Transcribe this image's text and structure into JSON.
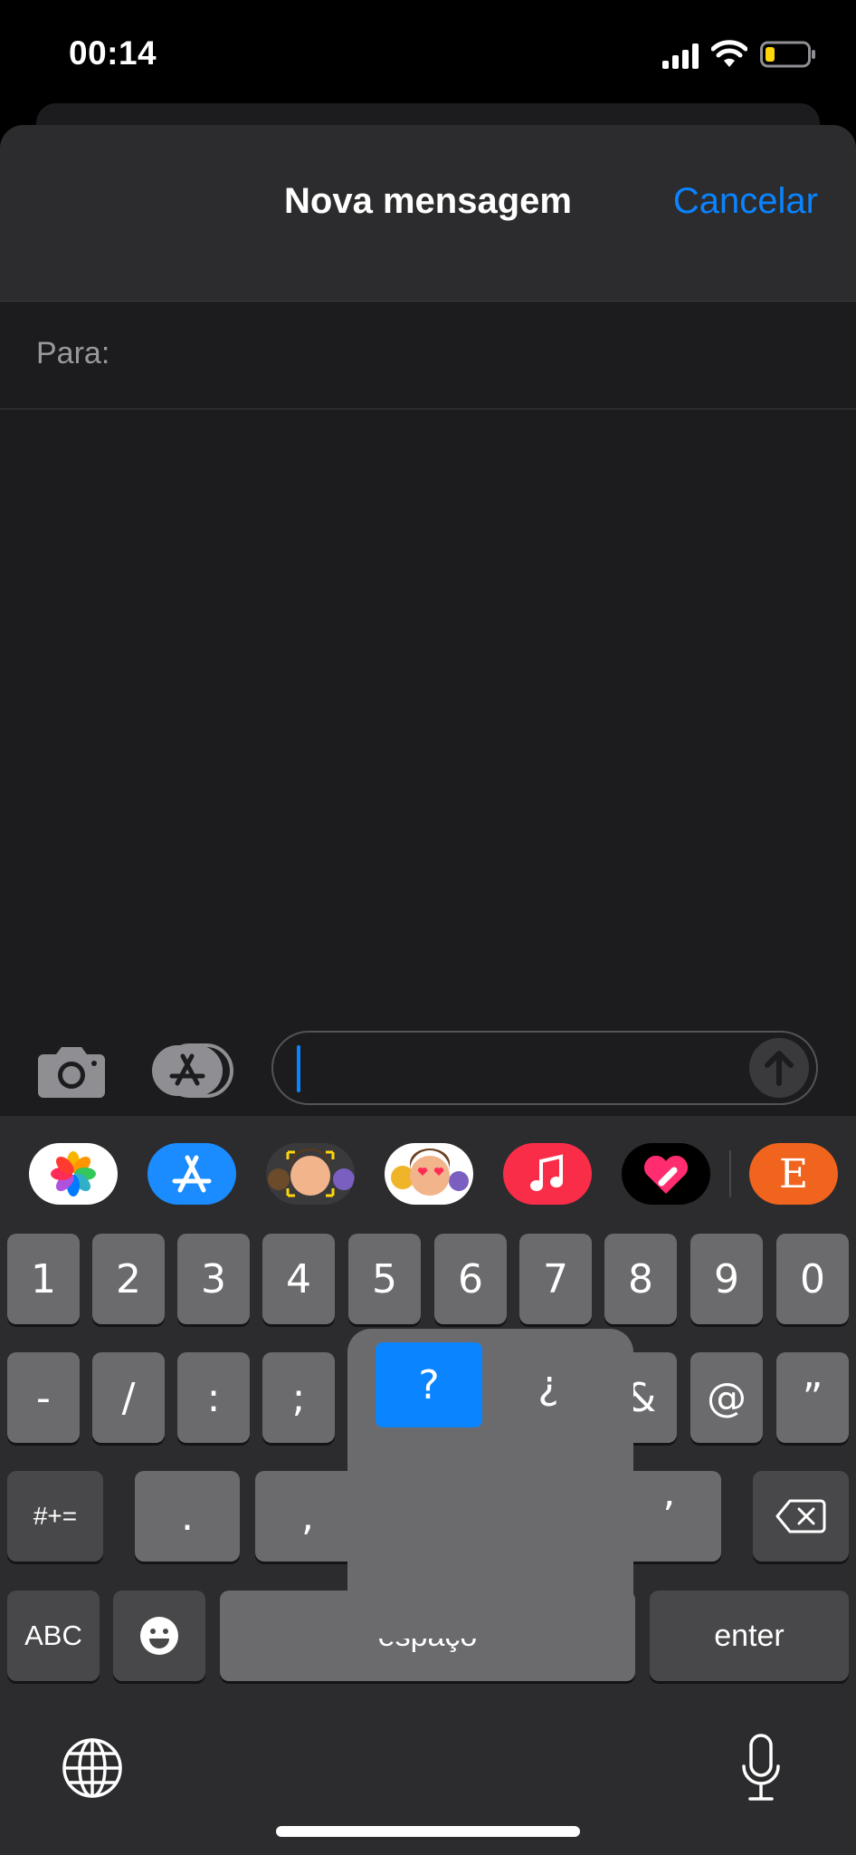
{
  "status": {
    "time": "00:14"
  },
  "header": {
    "title": "Nova mensagem",
    "cancel_label": "Cancelar"
  },
  "recipient": {
    "label": "Para:"
  },
  "compose": {
    "camera_icon": "camera-icon",
    "apps_icon": "app-store-icon",
    "send_icon": "arrow-up-icon"
  },
  "app_strip": [
    {
      "name": "photos-app"
    },
    {
      "name": "app-store-app"
    },
    {
      "name": "memoji-camera-app"
    },
    {
      "name": "memoji-stickers-app"
    },
    {
      "name": "music-app"
    },
    {
      "name": "digital-touch-app"
    },
    {
      "name": "etsy-app",
      "label": "E"
    }
  ],
  "keyboard": {
    "row1": [
      "1",
      "2",
      "3",
      "4",
      "5",
      "6",
      "7",
      "8",
      "9",
      "0"
    ],
    "row2": [
      "-",
      "/",
      ":",
      ";",
      "&",
      "@",
      "”"
    ],
    "row3_mode": "#+=",
    "row3": [
      ".",
      ",",
      "!",
      "’"
    ],
    "row4": {
      "abc": "ABC",
      "space": "espaço",
      "enter": "enter"
    },
    "popup": {
      "selected": "?",
      "alternate": "¿"
    }
  },
  "colors": {
    "accent": "#0a84ff",
    "background": "#1c1c1e",
    "key": "#6b6b6e"
  }
}
